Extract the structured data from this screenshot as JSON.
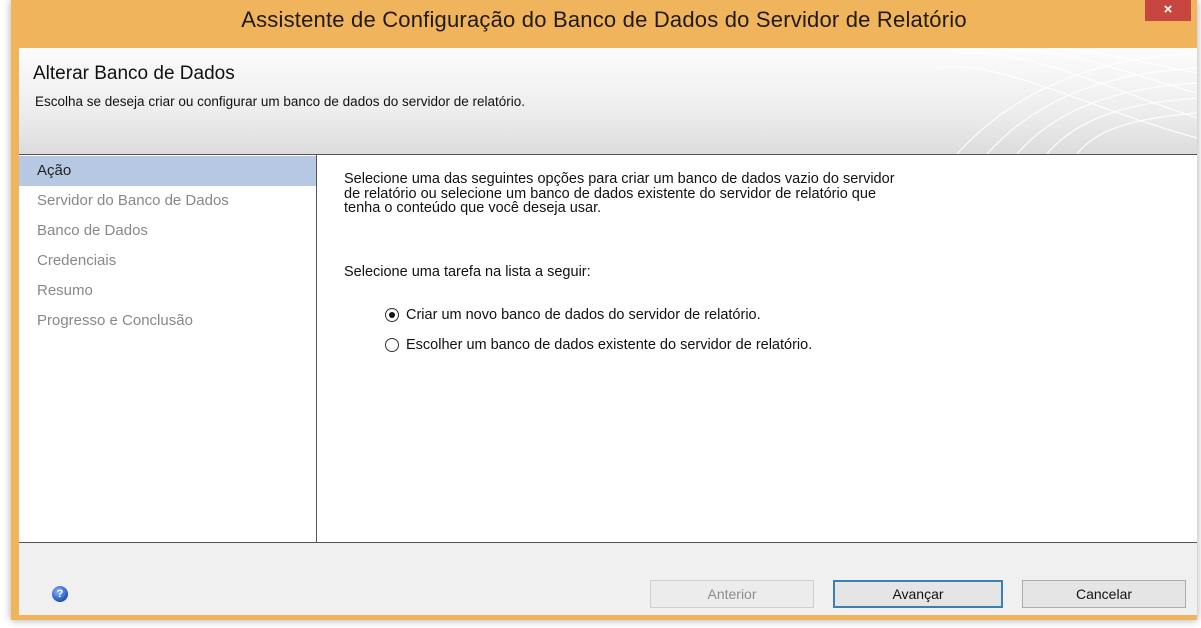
{
  "window": {
    "title": "Assistente de Configuração do Banco de Dados do Servidor de Relatório",
    "close_glyph": "×"
  },
  "header": {
    "title": "Alterar Banco de Dados",
    "subtitle": "Escolha se deseja criar ou configurar um banco de dados do servidor de relatório."
  },
  "nav": {
    "items": [
      {
        "label": "Ação",
        "selected": true
      },
      {
        "label": "Servidor do Banco de Dados"
      },
      {
        "label": "Banco de Dados"
      },
      {
        "label": "Credenciais"
      },
      {
        "label": "Resumo"
      },
      {
        "label": "Progresso e Conclusão"
      }
    ]
  },
  "content": {
    "description_lines": [
      "Selecione uma das seguintes opções para criar um banco de dados vazio do servidor",
      "de relatório ou selecione um banco de dados existente do servidor de relatório que",
      "tenha o conteúdo que você deseja usar."
    ],
    "prompt": "Selecione uma tarefa na lista a seguir:",
    "options": [
      {
        "label": "Criar um novo banco de dados do servidor de relatório.",
        "selected": true
      },
      {
        "label": "Escolher um banco de dados existente do servidor de relatório.",
        "selected": false
      }
    ]
  },
  "footer": {
    "help_icon": "help-icon",
    "back_label": "Anterior",
    "next_label": "Avançar",
    "cancel_label": "Cancelar"
  },
  "colors": {
    "titlebar": "#f0b45c",
    "close": "#c7463f",
    "nav_selected": "#b7c9e2",
    "primary_border": "#3c7fb1"
  }
}
